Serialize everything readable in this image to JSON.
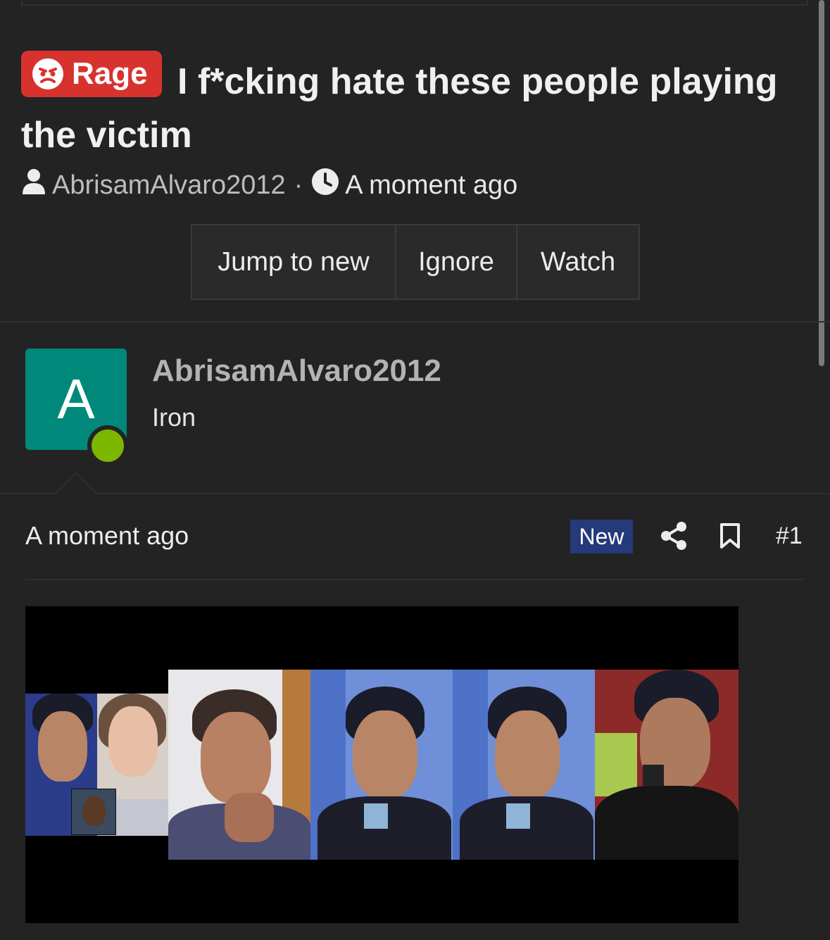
{
  "thread": {
    "prefix_label": "Rage",
    "title": "I f*cking hate these people playing the victim",
    "author": "AbrisamAlvaro2012",
    "separator": "·",
    "time": "A moment ago"
  },
  "actions": {
    "jump_label": "Jump to new",
    "ignore_label": "Ignore",
    "watch_label": "Watch"
  },
  "post": {
    "avatar_letter": "A",
    "username": "AbrisamAlvaro2012",
    "rank": "Iron",
    "time": "A moment ago",
    "new_badge": "New",
    "number": "#1"
  },
  "icons": {
    "prefix": "angry-face-icon",
    "author": "user-icon",
    "time": "clock-icon",
    "share": "share-icon",
    "bookmark": "bookmark-icon"
  },
  "colors": {
    "background": "#232323",
    "prefix_red": "#d8322f",
    "avatar_teal": "#00897b",
    "online_green": "#7cb700",
    "new_badge_blue": "#253a7a"
  }
}
